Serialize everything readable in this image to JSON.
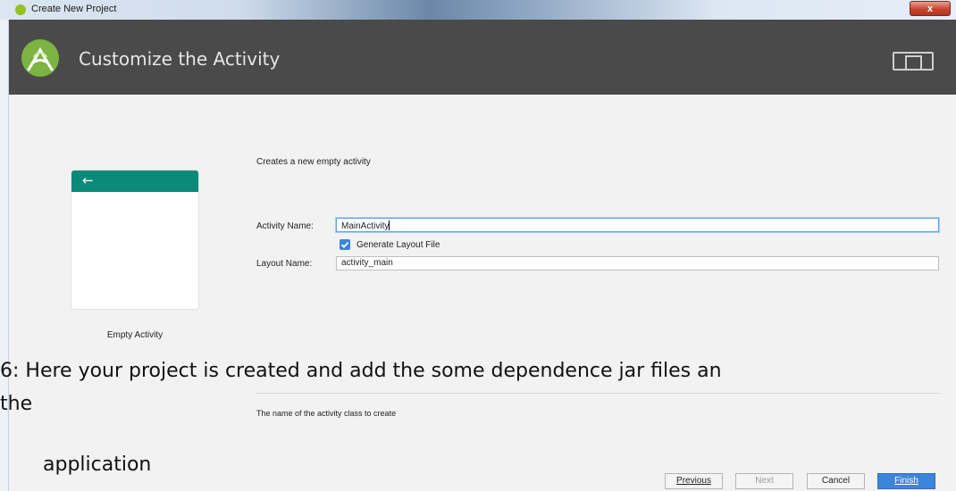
{
  "window": {
    "title": "Create New Project",
    "close_label": "x"
  },
  "header": {
    "title": "Customize the Activity"
  },
  "template": {
    "back_arrow": "←",
    "caption": "Empty Activity"
  },
  "form": {
    "description": "Creates a new empty activity",
    "activity_name_label": "Activity Name:",
    "activity_name_value": "MainActivity",
    "generate_layout_label": "Generate Layout File",
    "generate_layout_checked": true,
    "layout_name_label": "Layout Name:",
    "layout_name_value": "activity_main",
    "help_text": "The name of the activity class to create"
  },
  "buttons": {
    "previous": "Previous",
    "next": "Next",
    "cancel": "Cancel",
    "finish": "Finish"
  },
  "overlay_text": {
    "line1": "6: Here your project is created and add the some dependence jar files an",
    "line2": "the",
    "line3": "application"
  },
  "colors": {
    "header_bg": "#4a4a4a",
    "accent_teal": "#0b8a7a",
    "primary_blue": "#3b86d9",
    "android_green": "#7cb342"
  }
}
